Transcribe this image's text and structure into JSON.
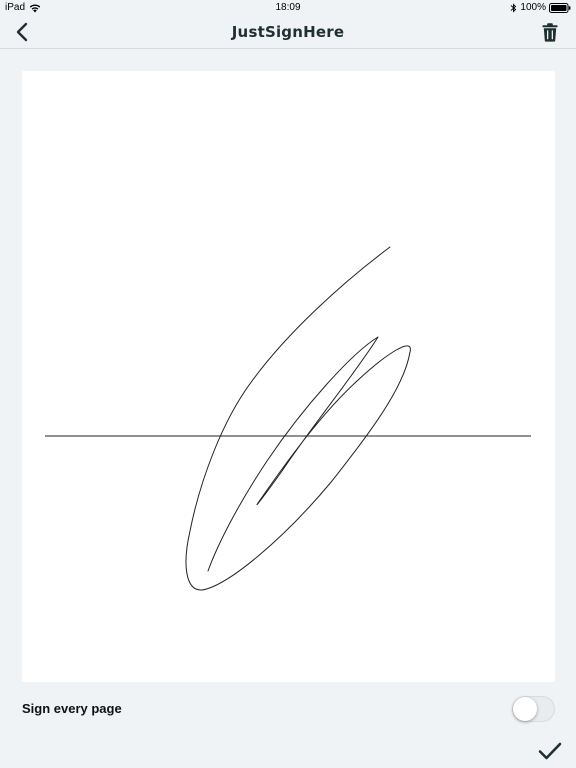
{
  "status_bar": {
    "device": "iPad",
    "time": "18:09",
    "battery": "100%",
    "icons": [
      "wifi-icon",
      "bluetooth-icon",
      "battery-icon"
    ]
  },
  "nav": {
    "title": "JustSignHere",
    "back_icon": "chevron-left-icon",
    "delete_icon": "trash-icon"
  },
  "options": {
    "sign_every_page_label": "Sign every page",
    "sign_every_page_enabled": false
  },
  "actions": {
    "confirm_icon": "checkmark-icon"
  },
  "colors": {
    "background": "#eff3f6",
    "accent": "#1f2f33",
    "canvas": "#ffffff"
  }
}
